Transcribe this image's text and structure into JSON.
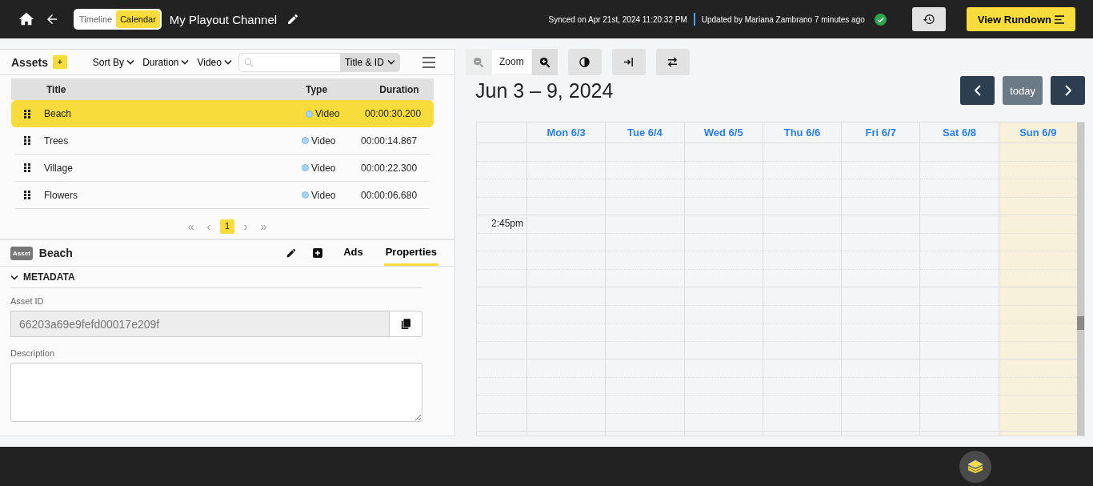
{
  "topbar": {
    "view_toggle": [
      {
        "label": "Timeline",
        "selected": false
      },
      {
        "label": "Calendar",
        "selected": true
      }
    ],
    "channel_title": "My Playout Channel",
    "sync_status": "Synced on Apr 21st, 2024 11:20:32 PM",
    "update_status": "Updated by Mariana Zambrano 7 minutes ago",
    "view_rundown": "View Rundown"
  },
  "assets": {
    "title": "Assets",
    "add_label": "+",
    "filters": [
      "Sort By",
      "Duration",
      "Video"
    ],
    "search": {
      "scope": "Title & ID"
    },
    "columns": [
      "Title",
      "Type",
      "Duration"
    ],
    "rows": [
      {
        "title": "Beach",
        "type": "Video",
        "duration": "00:00:30.200",
        "selected": true
      },
      {
        "title": "Trees",
        "type": "Video",
        "duration": "00:00:14.867",
        "selected": false
      },
      {
        "title": "Village",
        "type": "Video",
        "duration": "00:00:22.300",
        "selected": false
      },
      {
        "title": "Flowers",
        "type": "Video",
        "duration": "00:00:06.680",
        "selected": false
      }
    ],
    "pagination": {
      "first": "«",
      "prev": "‹",
      "pages": [
        {
          "label": "1",
          "selected": true
        }
      ],
      "next": "›",
      "last": "»"
    }
  },
  "detail": {
    "badge": "Asset",
    "name": "Beach",
    "tabs": [
      {
        "label": "Ads",
        "selected": false
      },
      {
        "label": "Properties",
        "selected": true
      }
    ],
    "section": {
      "title": "METADATA",
      "expanded": true
    },
    "asset_id": {
      "label": "Asset ID",
      "value": "66203a69e9fefd00017e209f"
    },
    "description": {
      "label": "Description"
    }
  },
  "calendar": {
    "zoom_label": "Zoom",
    "range": "Jun 3 – 9, 2024",
    "today": "today",
    "days": [
      {
        "label": "Mon 6/3",
        "today": false
      },
      {
        "label": "Tue 6/4",
        "today": false
      },
      {
        "label": "Wed 6/5",
        "today": false
      },
      {
        "label": "Thu 6/6",
        "today": false
      },
      {
        "label": "Fri 6/7",
        "today": false
      },
      {
        "label": "Sat 6/8",
        "today": false
      },
      {
        "label": "Sun 6/9",
        "today": true
      }
    ],
    "time_label": "2:45pm"
  }
}
